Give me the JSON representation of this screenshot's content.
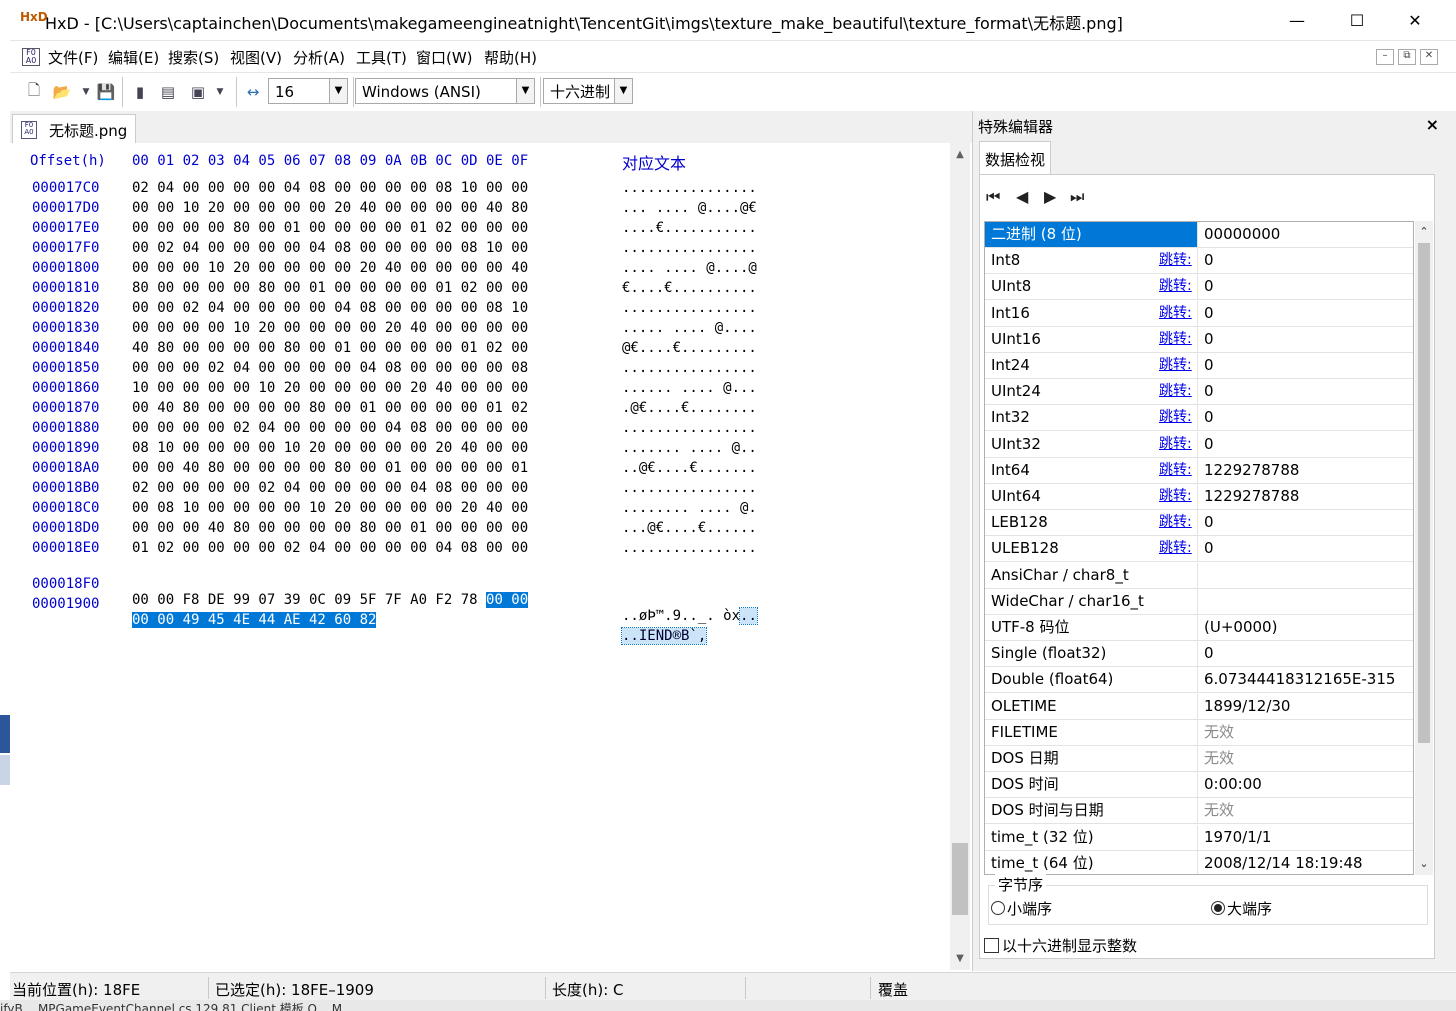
{
  "window": {
    "title": "HxD - [C:\\Users\\captainchen\\Documents\\makegameengineatnight\\TencentGit\\imgs\\texture_make_beautiful\\texture_format\\无标题.png]",
    "minimize": "—",
    "maximize": "☐",
    "close": "✕"
  },
  "menu": [
    "文件(F)",
    "编辑(E)",
    "搜索(S)",
    "视图(V)",
    "分析(A)",
    "工具(T)",
    "窗口(W)",
    "帮助(H)"
  ],
  "mdi": {
    "min": "–",
    "restore": "⧉",
    "close": "✕"
  },
  "toolbar": {
    "bytes_per_row": "16",
    "charset": "Windows (ANSI)",
    "offset_base": "十六进制"
  },
  "tab": {
    "label": "无标题.png"
  },
  "hex": {
    "header_offset": "Offset(h)",
    "header_cols": "00 01 02 03 04 05 06 07 08 09 0A 0B 0C 0D 0E 0F",
    "header_text": "对应文本",
    "rows": [
      {
        "off": "000017C0",
        "bytes": "02 04 00 00 00 00 04 08 00 00 00 00 08 10 00 00",
        "asc": "................"
      },
      {
        "off": "000017D0",
        "bytes": "00 00 10 20 00 00 00 00 20 40 00 00 00 00 40 80",
        "asc": "... .... @....@€"
      },
      {
        "off": "000017E0",
        "bytes": "00 00 00 00 80 00 01 00 00 00 00 01 02 00 00 00",
        "asc": "....€..........."
      },
      {
        "off": "000017F0",
        "bytes": "00 02 04 00 00 00 00 04 08 00 00 00 00 08 10 00",
        "asc": "................"
      },
      {
        "off": "00001800",
        "bytes": "00 00 00 10 20 00 00 00 00 20 40 00 00 00 00 40",
        "asc": ".... .... @....@"
      },
      {
        "off": "00001810",
        "bytes": "80 00 00 00 00 80 00 01 00 00 00 00 01 02 00 00",
        "asc": "€....€.........."
      },
      {
        "off": "00001820",
        "bytes": "00 00 02 04 00 00 00 00 04 08 00 00 00 00 08 10",
        "asc": "................"
      },
      {
        "off": "00001830",
        "bytes": "00 00 00 00 10 20 00 00 00 00 20 40 00 00 00 00",
        "asc": "..... .... @...."
      },
      {
        "off": "00001840",
        "bytes": "40 80 00 00 00 00 80 00 01 00 00 00 00 01 02 00",
        "asc": "@€....€........."
      },
      {
        "off": "00001850",
        "bytes": "00 00 00 02 04 00 00 00 00 04 08 00 00 00 00 08",
        "asc": "................"
      },
      {
        "off": "00001860",
        "bytes": "10 00 00 00 00 10 20 00 00 00 00 20 40 00 00 00",
        "asc": "...... .... @..."
      },
      {
        "off": "00001870",
        "bytes": "00 40 80 00 00 00 00 80 00 01 00 00 00 00 01 02",
        "asc": ".@€....€........"
      },
      {
        "off": "00001880",
        "bytes": "00 00 00 00 02 04 00 00 00 00 04 08 00 00 00 00",
        "asc": "................"
      },
      {
        "off": "00001890",
        "bytes": "08 10 00 00 00 00 10 20 00 00 00 00 20 40 00 00",
        "asc": "....... .... @.."
      },
      {
        "off": "000018A0",
        "bytes": "00 00 40 80 00 00 00 00 80 00 01 00 00 00 00 01",
        "asc": "..@€....€......."
      },
      {
        "off": "000018B0",
        "bytes": "02 00 00 00 00 02 04 00 00 00 00 04 08 00 00 00",
        "asc": "................"
      },
      {
        "off": "000018C0",
        "bytes": "00 08 10 00 00 00 00 10 20 00 00 00 00 20 40 00",
        "asc": "........ .... @."
      },
      {
        "off": "000018D0",
        "bytes": "00 00 00 40 80 00 00 00 00 80 00 01 00 00 00 00",
        "asc": "...@€....€......"
      },
      {
        "off": "000018E0",
        "bytes": "01 02 00 00 00 00 02 04 00 00 00 00 04 08 00 00",
        "asc": "................"
      }
    ],
    "row_18F0": {
      "off": "000018F0",
      "bytes_plain": "00 00 F8 DE 99 07 39 0C 09 5F 7F A0 F2 78 ",
      "bytes_sel": "00 00",
      "asc_plain": "..øÞ™.9.._. òx",
      "asc_sel": ".."
    },
    "row_1900": {
      "off": "00001900",
      "bytes_sel": "00 00 49 45 4E 44 AE 42 60 82",
      "asc_sel": "..IEND®B`‚"
    }
  },
  "special": {
    "title": "特殊编辑器",
    "close": "×",
    "tab": "数据检视",
    "nav": {
      "first": "⏮",
      "prev": "◀",
      "next": "▶",
      "last": "⏭"
    },
    "jump_label": "跳转:",
    "rows": [
      {
        "name": "二进制 (8 位)",
        "val": "00000000",
        "jump": false
      },
      {
        "name": "Int8",
        "val": "0",
        "jump": true
      },
      {
        "name": "UInt8",
        "val": "0",
        "jump": true
      },
      {
        "name": "Int16",
        "val": "0",
        "jump": true
      },
      {
        "name": "UInt16",
        "val": "0",
        "jump": true
      },
      {
        "name": "Int24",
        "val": "0",
        "jump": true
      },
      {
        "name": "UInt24",
        "val": "0",
        "jump": true
      },
      {
        "name": "Int32",
        "val": "0",
        "jump": true
      },
      {
        "name": "UInt32",
        "val": "0",
        "jump": true
      },
      {
        "name": "Int64",
        "val": "1229278788",
        "jump": true
      },
      {
        "name": "UInt64",
        "val": "1229278788",
        "jump": true
      },
      {
        "name": "LEB128",
        "val": "0",
        "jump": true
      },
      {
        "name": "ULEB128",
        "val": "0",
        "jump": true
      },
      {
        "name": "AnsiChar / char8_t",
        "val": "",
        "jump": false
      },
      {
        "name": "WideChar / char16_t",
        "val": "",
        "jump": false
      },
      {
        "name": "UTF-8 码位",
        "val": " (U+0000)",
        "jump": false
      },
      {
        "name": "Single (float32)",
        "val": "0",
        "jump": false
      },
      {
        "name": "Double (float64)",
        "val": "6.07344418312165E-315",
        "jump": false
      },
      {
        "name": "OLETIME",
        "val": "1899/12/30",
        "jump": false
      },
      {
        "name": "FILETIME",
        "val": "无效",
        "jump": false,
        "dim": true
      },
      {
        "name": "DOS 日期",
        "val": "无效",
        "jump": false,
        "dim": true
      },
      {
        "name": "DOS 时间",
        "val": "0:00:00",
        "jump": false
      },
      {
        "name": "DOS 时间与日期",
        "val": "无效",
        "jump": false,
        "dim": true
      },
      {
        "name": "time_t (32 位)",
        "val": "1970/1/1",
        "jump": false
      },
      {
        "name": "time_t (64 位)",
        "val": "2008/12/14 18:19:48",
        "jump": false
      }
    ],
    "byte_order_label": "字节序",
    "little_endian": "小端序",
    "big_endian": "大端序",
    "hex_int_label": "以十六进制显示整数"
  },
  "status": {
    "position": "当前位置(h):  18FE",
    "selected": "已选定(h):  18FE–1909",
    "length": "长度(h):  C",
    "mode": "覆盖"
  },
  "background_text": "ifyB...    MPGameEventChannel.cs                         129    81      Client                    模板               O... M..."
}
